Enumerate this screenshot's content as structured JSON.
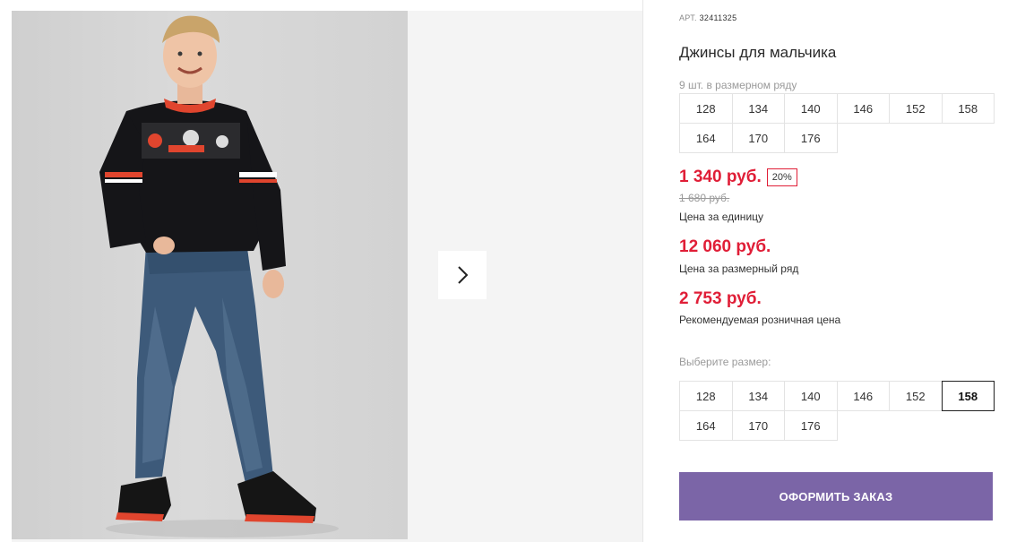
{
  "gallery": {
    "next_icon": "chevron-right-icon"
  },
  "product": {
    "art_label": "АРТ.",
    "art_number": "32411325",
    "title": "Джинсы для мальчика",
    "pack_note": "9 шт. в размерном ряду",
    "pack_sizes": [
      "128",
      "134",
      "140",
      "146",
      "152",
      "158",
      "164",
      "170",
      "176"
    ],
    "price": "1 340 руб.",
    "discount": "20%",
    "old_price": "1 680 руб.",
    "price_label": "Цена за единицу",
    "series_price": "12 060 руб.",
    "series_label": "Цена за размерный ряд",
    "rrp_price": "2 753 руб.",
    "rrp_label": "Рекомендуемая розничная цена",
    "choose_size_label": "Выберите размер:",
    "size_options": [
      "128",
      "134",
      "140",
      "146",
      "152",
      "158",
      "164",
      "170",
      "176"
    ],
    "selected_size": "158",
    "order_button": "ОФОРМИТЬ ЗАКАЗ"
  },
  "colors": {
    "price_red": "#e01e37",
    "button_purple": "#7b65a7"
  }
}
